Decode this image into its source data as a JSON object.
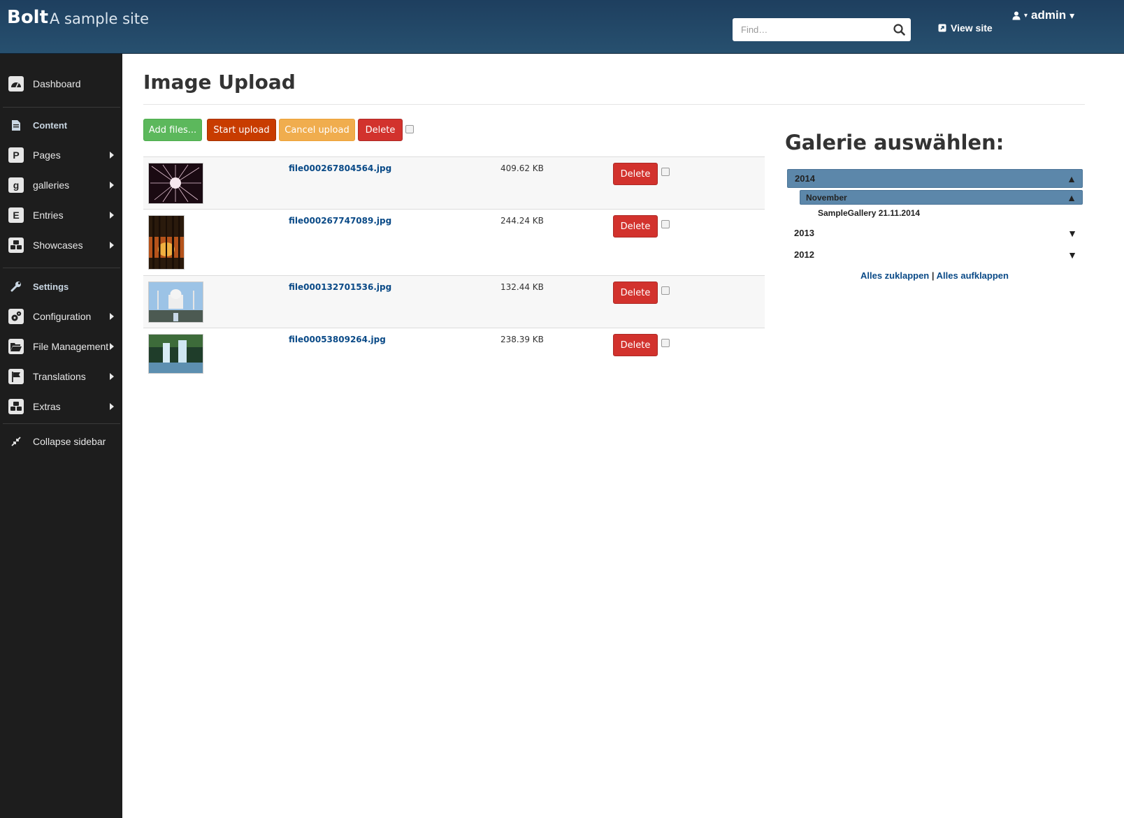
{
  "header": {
    "brand": "Bolt",
    "tagline": "A sample site",
    "search_placeholder": "Find…",
    "view_site": "View site",
    "user": "admin"
  },
  "sidebar": {
    "dashboard": "Dashboard",
    "content_section": "Content",
    "pages": "Pages",
    "galleries": "galleries",
    "entries": "Entries",
    "showcases": "Showcases",
    "settings_section": "Settings",
    "configuration": "Configuration",
    "file_management": "File Management",
    "translations": "Translations",
    "extras": "Extras",
    "collapse": "Collapse sidebar",
    "letters": {
      "pages": "P",
      "galleries": "g",
      "entries": "E"
    }
  },
  "main": {
    "title": "Image Upload",
    "buttons": {
      "add_files": "Add files...",
      "start_upload": "Start upload",
      "cancel_upload": "Cancel upload",
      "delete": "Delete"
    },
    "files": [
      {
        "name": "file000267804564.jpg",
        "size": "409.62 KB",
        "delete": "Delete"
      },
      {
        "name": "file000267747089.jpg",
        "size": "244.24 KB",
        "delete": "Delete"
      },
      {
        "name": "file000132701536.jpg",
        "size": "132.44 KB",
        "delete": "Delete"
      },
      {
        "name": "file00053809264.jpg",
        "size": "238.39 KB",
        "delete": "Delete"
      }
    ]
  },
  "gallery": {
    "title": "Galerie auswählen:",
    "years": [
      {
        "label": "2014",
        "arrow": "▲"
      },
      {
        "label": "2013",
        "arrow": "▼"
      },
      {
        "label": "2012",
        "arrow": "▼"
      }
    ],
    "month": {
      "label": "November",
      "arrow": "▲"
    },
    "item": "SampleGallery 21.11.2014",
    "collapse_all": "Alles zuklappen",
    "separator": "|",
    "expand_all": "Alles aufklappen"
  },
  "colors": {
    "header": "#27506f",
    "sidebar": "#1d1d1d",
    "success": "#5cb85c",
    "start": "#c83c00",
    "warning": "#f0ad4e",
    "danger": "#d2322d",
    "tree_active": "#5c87aa"
  }
}
